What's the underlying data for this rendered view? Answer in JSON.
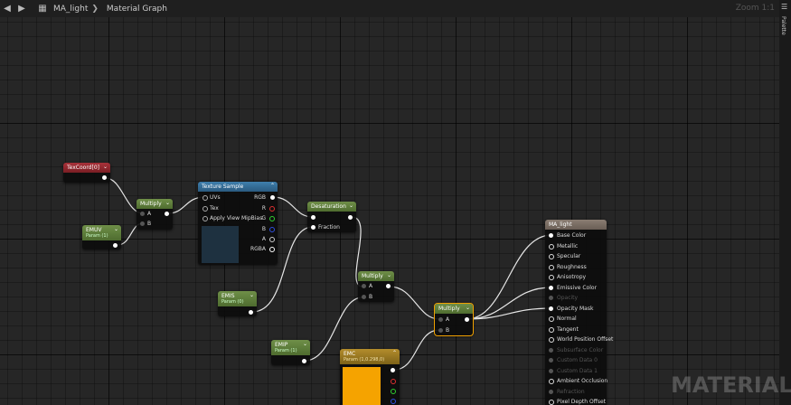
{
  "toolbar": {
    "back_icon": "arrow-left-icon",
    "forward_icon": "arrow-right-icon",
    "hierarchy_icon": "hierarchy-icon",
    "asset_name": "MA_light",
    "graph_name": "Material Graph",
    "zoom": "Zoom 1:1"
  },
  "palette": {
    "label": "Palette"
  },
  "watermark": "MATERIAL",
  "nodes": {
    "texcoord": {
      "title": "TexCoord[0]"
    },
    "multiply1": {
      "title": "Multiply",
      "pin_a": "A",
      "pin_b": "B"
    },
    "emuv": {
      "title": "EMUV",
      "subtitle": "Param (1)"
    },
    "texture_sample": {
      "title": "Texture Sample",
      "pins_in": [
        "UVs",
        "Tex",
        "Apply View MipBias"
      ],
      "pins_out": [
        "RGB",
        "R",
        "G",
        "B",
        "A",
        "RGBA"
      ]
    },
    "desaturation": {
      "title": "Desaturation",
      "pin_fraction": "Fraction"
    },
    "emis": {
      "title": "EMIS",
      "subtitle": "Param (0)"
    },
    "multiply2": {
      "title": "Multiply",
      "pin_a": "A",
      "pin_b": "B"
    },
    "multiply3": {
      "title": "Multiply",
      "pin_a": "A",
      "pin_b": "B"
    },
    "emip": {
      "title": "EMIP",
      "subtitle": "Param (1)"
    },
    "emc": {
      "title": "EMC",
      "subtitle": "Param (1,0.298,0)",
      "color": "#f5a300"
    },
    "result": {
      "title": "MA_light",
      "pins": [
        "Base Color",
        "Metallic",
        "Specular",
        "Roughness",
        "Anisotropy",
        "Emissive Color",
        "Opacity",
        "Opacity Mask",
        "Normal",
        "Tangent",
        "World Position Offset",
        "Subsurface Color",
        "Custom Data 0",
        "Custom Data 1",
        "Ambient Occlusion",
        "Refraction",
        "Pixel Depth Offset"
      ],
      "disabled": [
        6,
        11,
        12,
        13,
        15
      ]
    }
  }
}
